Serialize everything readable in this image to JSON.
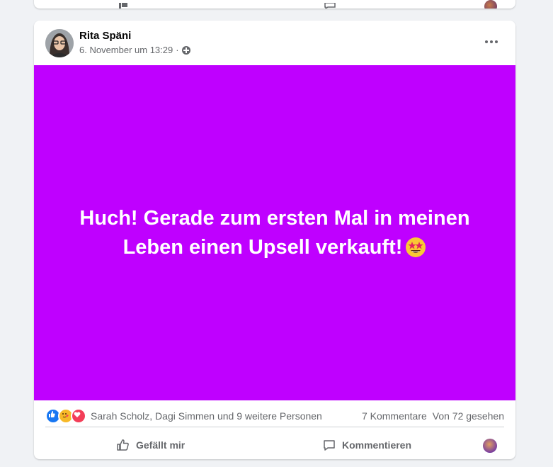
{
  "post": {
    "author": "Rita Späni",
    "timestamp": "6. November um 13:29",
    "separator": "·",
    "audience_icon": "globe-icon",
    "background_color": "#bf00ff",
    "text": "Huch! Gerade zum ersten Mal in meinen Leben einen Upsell verkauft!",
    "emoji": "star-struck-emoji"
  },
  "reactions": {
    "icons": [
      "like-icon",
      "care-icon",
      "love-icon"
    ],
    "reactors": "Sarah Scholz, Dagi Simmen und 9 weitere Personen",
    "comments": "7 Kommentare",
    "views": "Von 72 gesehen"
  },
  "actions": {
    "like_label": "Gefällt mir",
    "comment_label": "Kommentieren"
  },
  "colors": {
    "page_bg": "#f0f2f5",
    "card_bg": "#ffffff",
    "secondary_text": "#65676b",
    "like_blue": "#1877f2"
  }
}
